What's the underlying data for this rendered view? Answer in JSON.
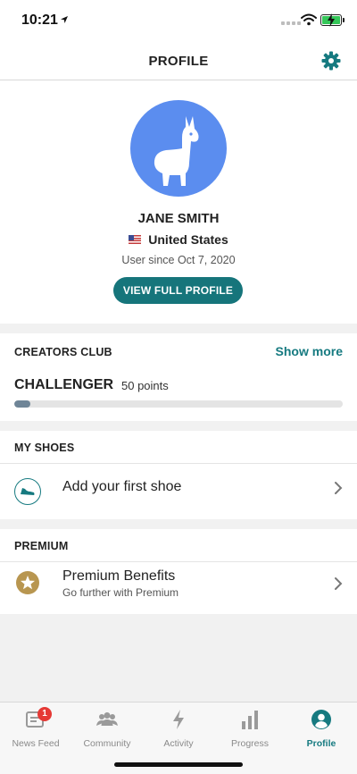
{
  "status_bar": {
    "time": "10:21"
  },
  "header": {
    "title": "PROFILE"
  },
  "profile": {
    "name": "JANE SMITH",
    "country": "United States",
    "member_since": "User since Oct 7, 2020",
    "view_button": "VIEW FULL PROFILE"
  },
  "creators_club": {
    "title": "CREATORS CLUB",
    "show_more": "Show more",
    "level": "CHALLENGER",
    "points": "50 points",
    "progress_fraction": 0.05
  },
  "shoes": {
    "title": "MY SHOES",
    "add_label": "Add your first shoe"
  },
  "premium": {
    "title": "PREMIUM",
    "label": "Premium Benefits",
    "sublabel": "Go further with Premium"
  },
  "tabbar": {
    "tabs": [
      {
        "label": "News Feed",
        "icon": "news-feed-icon",
        "badge": "1"
      },
      {
        "label": "Community",
        "icon": "community-icon"
      },
      {
        "label": "Activity",
        "icon": "activity-icon"
      },
      {
        "label": "Progress",
        "icon": "progress-icon"
      },
      {
        "label": "Profile",
        "icon": "profile-icon",
        "active": true
      }
    ]
  },
  "colors": {
    "accent": "#167a80",
    "avatar_bg": "#5b8def",
    "premium_gold": "#b89650",
    "badge_red": "#e53935"
  }
}
